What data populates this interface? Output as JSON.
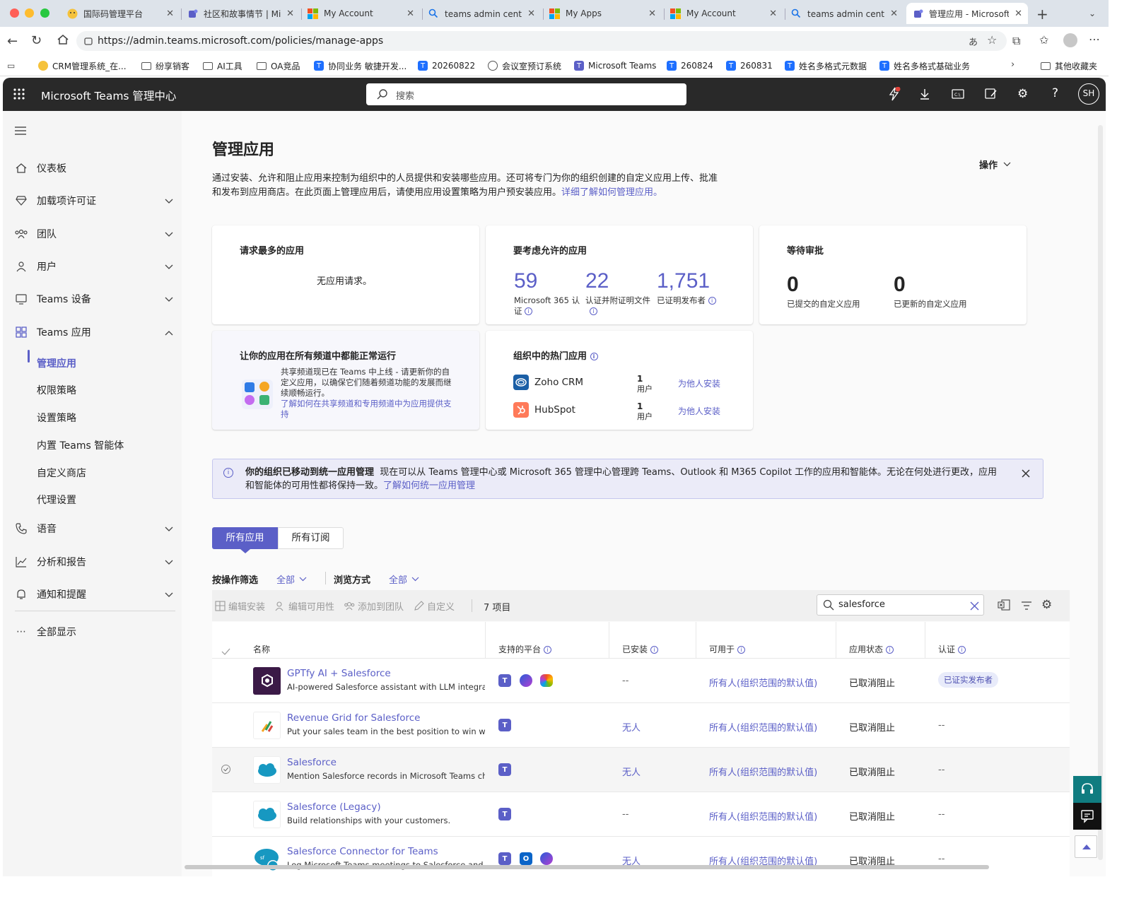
{
  "browser": {
    "tabs": [
      {
        "title": "国际码管理平台",
        "icon": "yellow-emoji-icon"
      },
      {
        "title": "社区和故事情节 | Microsoft",
        "icon": "teams-icon"
      },
      {
        "title": "My Account",
        "icon": "microsoft-icon"
      },
      {
        "title": "teams admin center - 搜索",
        "icon": "search-icon"
      },
      {
        "title": "My Apps",
        "icon": "microsoft-icon"
      },
      {
        "title": "My Account",
        "icon": "microsoft-icon"
      },
      {
        "title": "teams admin center - 搜索",
        "icon": "search-icon"
      },
      {
        "title": "管理应用 - Microsoft Teams",
        "icon": "teams-icon"
      }
    ],
    "url": "https://admin.teams.microsoft.com/policies/manage-apps",
    "bookmarks": [
      {
        "label": "CRM管理系统_在...",
        "icon": "emoji-icon"
      },
      {
        "label": "纷享销客",
        "icon": "folder-icon"
      },
      {
        "label": "AI工具",
        "icon": "folder-icon"
      },
      {
        "label": "OA竞品",
        "icon": "folder-icon"
      },
      {
        "label": "协同业务 敏捷开发...",
        "icon": "t-icon"
      },
      {
        "label": "20260822",
        "icon": "t-icon"
      },
      {
        "label": "会议室预订系统",
        "icon": "globe-icon"
      },
      {
        "label": "Microsoft Teams",
        "icon": "teams-icon"
      },
      {
        "label": "260824",
        "icon": "t-icon"
      },
      {
        "label": "260831",
        "icon": "t-icon"
      },
      {
        "label": "姓名多格式元数据",
        "icon": "t-icon"
      },
      {
        "label": "姓名多格式基础业务",
        "icon": "t-icon"
      }
    ],
    "other_bookmarks": "其他收藏夹"
  },
  "header": {
    "title": "Microsoft Teams 管理中心",
    "search_placeholder": "搜索",
    "avatar": "SH"
  },
  "sidebar": {
    "items": [
      {
        "label": "仪表板",
        "icon": "home-icon"
      },
      {
        "label": "加载项许可证",
        "icon": "diamond-icon"
      },
      {
        "label": "团队",
        "icon": "team-icon"
      },
      {
        "label": "用户",
        "icon": "user-icon"
      },
      {
        "label": "Teams 设备",
        "icon": "device-icon"
      },
      {
        "label": "Teams 应用",
        "icon": "apps-icon"
      }
    ],
    "subitems": [
      "管理应用",
      "权限策略",
      "设置策略",
      "内置 Teams 智能体",
      "自定义商店",
      "代理设置"
    ],
    "items2": [
      {
        "label": "语音",
        "icon": "phone-icon"
      },
      {
        "label": "分析和报告",
        "icon": "chart-icon"
      },
      {
        "label": "通知和提醒",
        "icon": "bell-icon"
      }
    ],
    "show_all": "全部显示"
  },
  "page": {
    "title": "管理应用",
    "actions": "操作",
    "desc1": "通过安装、允许和阻止应用来控制为组织中的人员提供和安装哪些应用。还可将专门为你的组织创建的自定义应用上传、批准",
    "desc2": "和发布到应用商店。在此页面上管理应用后，请使用应用设置策略为用户预安装应用。",
    "desc_link": "详细了解如何管理应用。"
  },
  "cards": {
    "most_requested": {
      "title": "请求最多的应用",
      "empty": "无应用请求。"
    },
    "consider": {
      "title": "要考虑允许的应用",
      "stats": [
        {
          "value": "59",
          "label1": "Microsoft 365 认",
          "label2": "证"
        },
        {
          "value": "22",
          "label1": "认证并附证明文件",
          "label2": ""
        },
        {
          "value": "1,751",
          "label1": "已证明发布者",
          "label2": ""
        }
      ]
    },
    "pending": {
      "title": "等待审批",
      "stats": [
        {
          "value": "0",
          "label": "已提交的自定义应用"
        },
        {
          "value": "0",
          "label": "已更新的自定义应用"
        }
      ]
    },
    "channels": {
      "title": "让你的应用在所有频道中都能正常运行",
      "body1": "共享频道现已在 Teams 中上线 - 请更新你的自",
      "body2": "定义应用，以确保它们随着频道功能的发展而继",
      "body3": "续顺畅运行。",
      "link1": "了解如何在共享频道和专用频道中为应用提供支",
      "link2": "持"
    },
    "popular": {
      "title": "组织中的热门应用",
      "apps": [
        {
          "name": "Zoho CRM",
          "count": "1",
          "unit": "用户",
          "action": "为他人安装"
        },
        {
          "name": "HubSpot",
          "count": "1",
          "unit": "用户",
          "action": "为他人安装"
        }
      ]
    }
  },
  "banner": {
    "title": "你的组织已移动到统一应用管理",
    "text1": "现在可以从 Teams 管理中心或 Microsoft 365 管理中心管理跨 Teams、Outlook 和 M365 Copilot 工作的应用和智能体。无论在何处进行更改，应用",
    "text2": "和智能体的可用性都将保持一致。",
    "link": "了解如何统一应用管理"
  },
  "tabs": [
    "所有应用",
    "所有订阅"
  ],
  "filters": {
    "filter_label": "按操作筛选",
    "filter_value": "全部",
    "browse_label": "浏览方式",
    "browse_value": "全部"
  },
  "toolbar": {
    "edit_install": "编辑安装",
    "edit_availability": "编辑可用性",
    "add_to_team": "添加到团队",
    "customize": "自定义",
    "count": "7 项目",
    "search_value": "salesforce"
  },
  "table": {
    "headers": [
      "名称",
      "支持的平台",
      "已安装",
      "可用于",
      "应用状态",
      "认证"
    ],
    "rows": [
      {
        "name": "GPTfy AI + Salesforce",
        "desc": "AI-powered Salesforce assistant with LLM integration",
        "installed": "--",
        "available": "所有人(组织范围的默认值)",
        "status": "已取消阻止",
        "cert": "已证实发布者",
        "platforms": [
          "teams",
          "m365",
          "copilot"
        ]
      },
      {
        "name": "Revenue Grid for Salesforce",
        "desc": "Put your sales team in the best position to win with guided selling",
        "installed": "无人",
        "available": "所有人(组织范围的默认值)",
        "status": "已取消阻止",
        "cert": "--",
        "platforms": [
          "teams"
        ]
      },
      {
        "name": "Salesforce",
        "desc": "Mention Salesforce records in Microsoft Teams chats and channels",
        "installed": "无人",
        "available": "所有人(组织范围的默认值)",
        "status": "已取消阻止",
        "cert": "--",
        "platforms": [
          "teams"
        ]
      },
      {
        "name": "Salesforce (Legacy)",
        "desc": "Build relationships with your customers.",
        "installed": "--",
        "available": "所有人(组织范围的默认值)",
        "status": "已取消阻止",
        "cert": "--",
        "platforms": [
          "teams"
        ]
      },
      {
        "name": "Salesforce Connector for Teams",
        "desc": "Log Microsoft Teams meetings to Salesforce and access records",
        "installed": "无人",
        "available": "所有人(组织范围的默认值)",
        "status": "已取消阻止",
        "cert": "--",
        "platforms": [
          "teams",
          "outlook",
          "m365"
        ]
      }
    ]
  },
  "colors": {
    "accent": "#5b5fc7",
    "header": "#292929"
  }
}
